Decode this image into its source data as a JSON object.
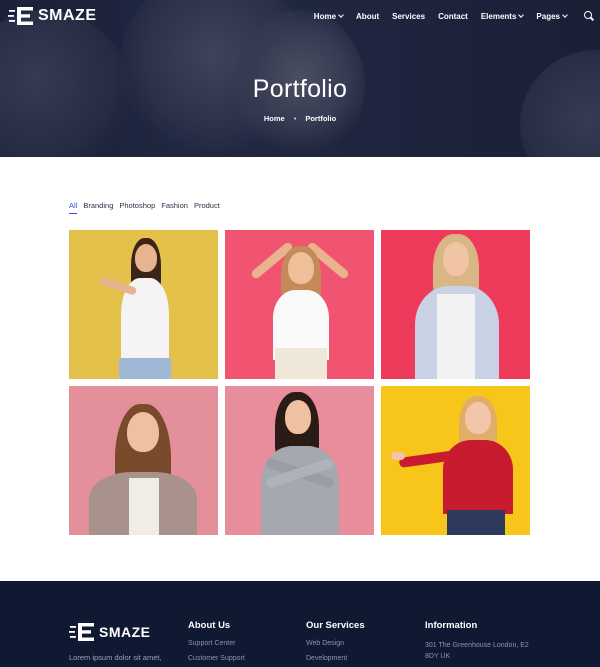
{
  "brand": {
    "name": "SMAZE"
  },
  "nav": {
    "items": [
      {
        "label": "Home",
        "dropdown": true
      },
      {
        "label": "About",
        "dropdown": false
      },
      {
        "label": "Services",
        "dropdown": false
      },
      {
        "label": "Contact",
        "dropdown": false
      },
      {
        "label": "Elements",
        "dropdown": true
      },
      {
        "label": "Pages",
        "dropdown": true
      }
    ],
    "search_icon": "search-icon"
  },
  "hero": {
    "title": "Portfolio",
    "breadcrumb": [
      "Home",
      "Portfolio"
    ],
    "breadcrumb_separator": "•"
  },
  "filters": {
    "items": [
      "All",
      "Branding",
      "Photoshop",
      "Fashion",
      "Product"
    ],
    "active": "All"
  },
  "gallery": {
    "tiles": [
      {
        "background": "#e3c14a",
        "subject": "woman-pointing-left"
      },
      {
        "background": "#f05470",
        "subject": "woman-holding-head"
      },
      {
        "background": "#ee3b5c",
        "subject": "woman-surprised-plaid-shirt"
      },
      {
        "background": "#e4909a",
        "subject": "woman-surprised-checked-shirt"
      },
      {
        "background": "#e88d9c",
        "subject": "woman-arms-crossed-pointing"
      },
      {
        "background": "#f8c51a",
        "subject": "woman-presenting-red-sweater"
      }
    ]
  },
  "footer": {
    "blurb": "Lorem ipsum dolor sit amet,",
    "columns": [
      {
        "title": "About Us",
        "links": [
          "Support Center",
          "Customer Support"
        ]
      },
      {
        "title": "Our Services",
        "links": [
          "Web Design",
          "Development"
        ]
      },
      {
        "title": "Information",
        "address": "301 The Greenhouse London, E2 8DY UK"
      }
    ]
  },
  "colors": {
    "accent": "#3358d4",
    "footer_bg": "#0f1a32",
    "hero_overlay": "#1f2640"
  }
}
